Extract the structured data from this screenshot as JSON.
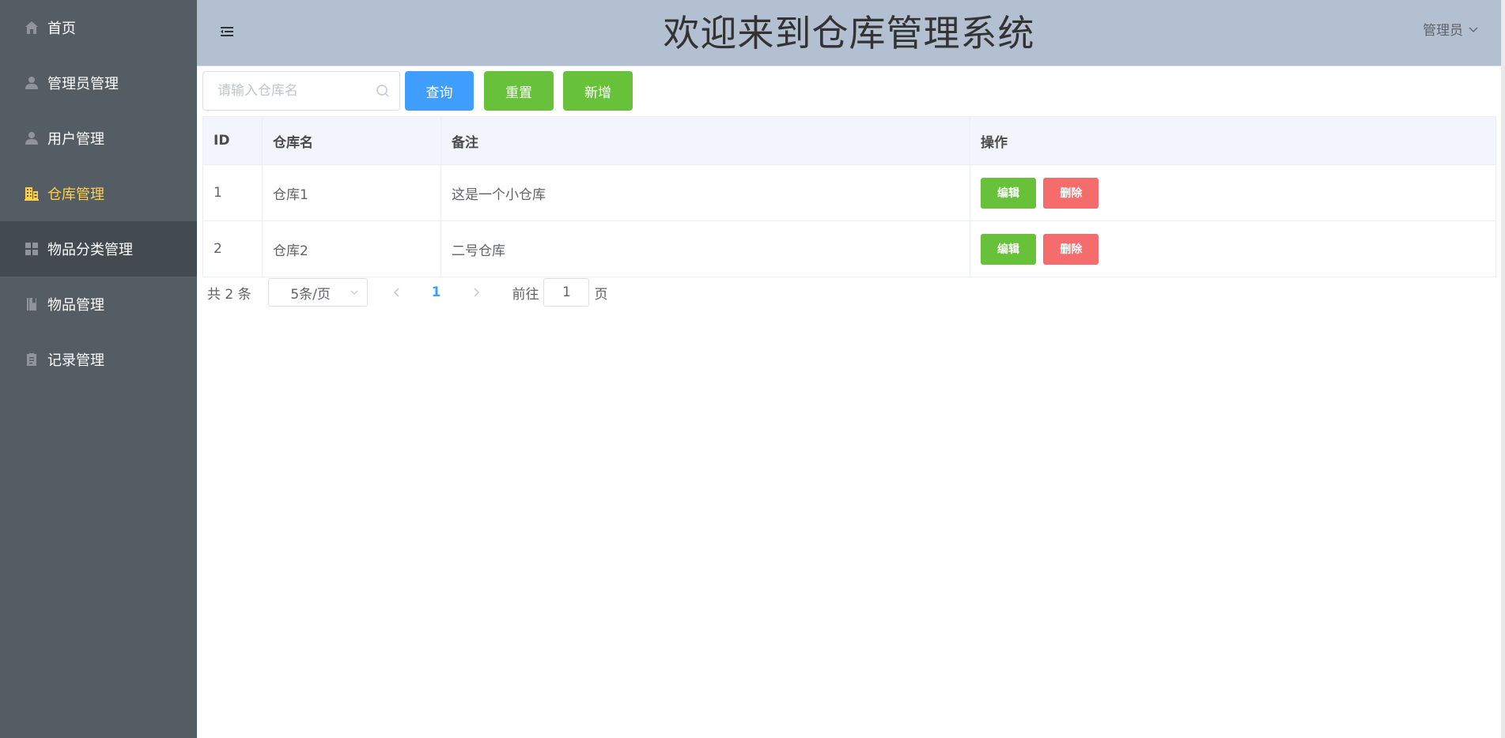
{
  "sidebar": {
    "items": [
      {
        "label": "首页",
        "icon": "home-icon"
      },
      {
        "label": "管理员管理",
        "icon": "user-icon"
      },
      {
        "label": "用户管理",
        "icon": "user-icon"
      },
      {
        "label": "仓库管理",
        "icon": "office-building-icon",
        "active": true
      },
      {
        "label": "物品分类管理",
        "icon": "grid-icon",
        "hover": true
      },
      {
        "label": "物品管理",
        "icon": "notebook-icon"
      },
      {
        "label": "记录管理",
        "icon": "clipboard-icon"
      }
    ],
    "active_color": "#ffd04b",
    "background": "#545c64"
  },
  "header": {
    "title": "欢迎来到仓库管理系统",
    "user_label": "管理员",
    "background": "#b3c0d1"
  },
  "toolbar": {
    "search_placeholder": "请输入仓库名",
    "search_value": "",
    "query_label": "查询",
    "reset_label": "重置",
    "add_label": "新增"
  },
  "table": {
    "columns": [
      "ID",
      "仓库名",
      "备注",
      "操作"
    ],
    "rows": [
      {
        "id": "1",
        "name": "仓库1",
        "remark": "这是一个小仓库",
        "edit": "编辑",
        "delete": "删除"
      },
      {
        "id": "2",
        "name": "仓库2",
        "remark": "二号仓库",
        "edit": "编辑",
        "delete": "删除"
      }
    ]
  },
  "pagination": {
    "total_text": "共 2 条",
    "page_size": "5条/页",
    "current_page": "1",
    "goto_prefix": "前往",
    "goto_value": "1",
    "goto_suffix": "页"
  },
  "colors": {
    "primary": "#409eff",
    "success": "#67c23a",
    "danger": "#f56c6c"
  }
}
